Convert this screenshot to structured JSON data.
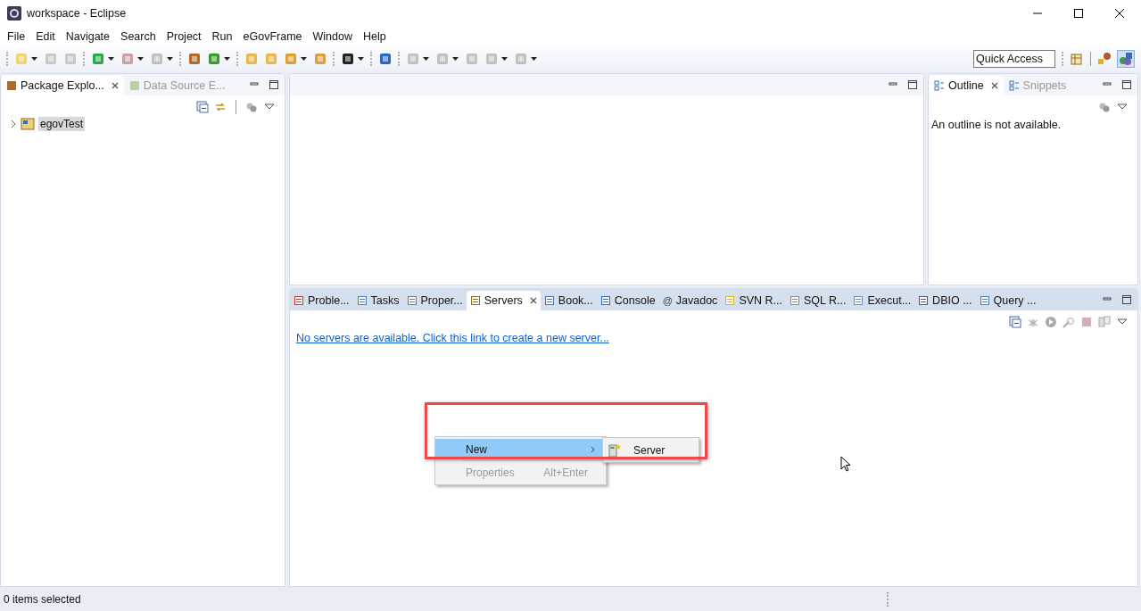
{
  "window": {
    "title": "workspace - Eclipse"
  },
  "menu": [
    "File",
    "Edit",
    "Navigate",
    "Search",
    "Project",
    "Run",
    "eGovFrame",
    "Window",
    "Help"
  ],
  "quick_access": {
    "placeholder": "Quick Access"
  },
  "left_panel": {
    "tabs": [
      {
        "label": "Package Explo...",
        "selected": true
      },
      {
        "label": "Data Source E...",
        "selected": false
      }
    ],
    "tree": [
      {
        "label": "egovTest",
        "expanded": false,
        "selected": true
      }
    ]
  },
  "outline_panel": {
    "tabs": [
      {
        "label": "Outline",
        "selected": true
      },
      {
        "label": "Snippets",
        "selected": false
      }
    ],
    "message": "An outline is not available."
  },
  "bottom_panel": {
    "tabs": [
      {
        "label": "Proble...",
        "selected": false
      },
      {
        "label": "Tasks",
        "selected": false
      },
      {
        "label": "Proper...",
        "selected": false
      },
      {
        "label": "Servers",
        "selected": true
      },
      {
        "label": "Book...",
        "selected": false
      },
      {
        "label": "Console",
        "selected": false
      },
      {
        "label": "Javadoc",
        "selected": false,
        "glyph": "@"
      },
      {
        "label": "SVN R...",
        "selected": false
      },
      {
        "label": "SQL R...",
        "selected": false
      },
      {
        "label": "Execut...",
        "selected": false
      },
      {
        "label": "DBIO ...",
        "selected": false
      },
      {
        "label": "Query ...",
        "selected": false
      }
    ],
    "link": "No servers are available. Click this link to create a new server..."
  },
  "context_menu": {
    "items": [
      {
        "label": "New",
        "submenu": true,
        "selected": true,
        "disabled": false
      },
      {
        "label": "Properties",
        "shortcut": "Alt+Enter",
        "submenu": false,
        "selected": false,
        "disabled": true
      }
    ]
  },
  "submenu": {
    "items": [
      {
        "label": "Server"
      }
    ]
  },
  "status_bar": {
    "text": "0 items selected"
  }
}
